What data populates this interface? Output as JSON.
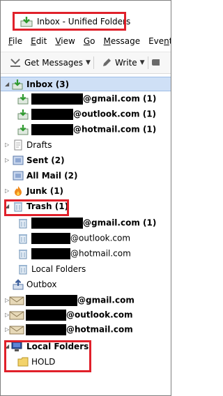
{
  "window": {
    "title": "Inbox - Unified Folders"
  },
  "menu": [
    "File",
    "Edit",
    "View",
    "Go",
    "Message",
    "Events an"
  ],
  "menu_underline": [
    "F",
    "E",
    "V",
    "G",
    "M",
    "n"
  ],
  "toolbar": {
    "get_messages": "Get Messages",
    "write": "Write"
  },
  "folders": {
    "inbox": "Inbox (3)",
    "inbox_gmail": "@gmail.com (1)",
    "inbox_outlook": "@outlook.com (1)",
    "inbox_hotmail": "@hotmail.com (1)",
    "drafts": "Drafts",
    "sent": "Sent (2)",
    "allmail": "All Mail (2)",
    "junk": "Junk (1)",
    "trash": "Trash (1)",
    "trash_gmail": "@gmail.com (1)",
    "trash_outlook": "@outlook.com",
    "trash_hotmail": "@hotmail.com",
    "trash_local": "Local Folders",
    "outbox": "Outbox",
    "acct_gmail": "@gmail.com",
    "acct_outlook": "@outlook.com",
    "acct_hotmail": "@hotmail.com",
    "local_folders": "Local Folders",
    "hold": "HOLD"
  },
  "colors": {
    "highlight": "#e0202a",
    "selection": "#cfe0f6",
    "inbox_green": "#3aa23a"
  }
}
